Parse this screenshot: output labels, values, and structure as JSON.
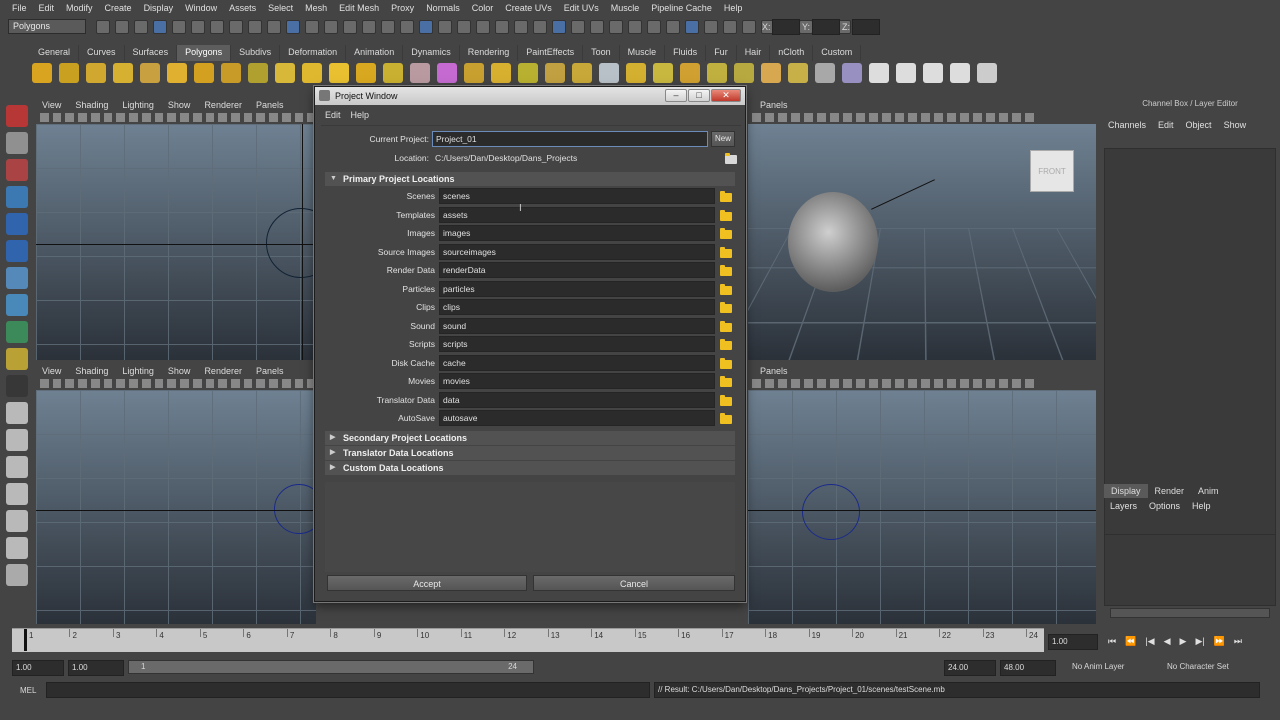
{
  "menubar": [
    "File",
    "Edit",
    "Modify",
    "Create",
    "Display",
    "Window",
    "Assets",
    "Select",
    "Mesh",
    "Edit Mesh",
    "Proxy",
    "Normals",
    "Color",
    "Create UVs",
    "Edit UVs",
    "Muscle",
    "Pipeline Cache",
    "Help"
  ],
  "statusline": {
    "mode": "Polygons",
    "x_label": "X:",
    "y_label": "Y:",
    "z_label": "Z:"
  },
  "shelf_tabs": [
    "General",
    "Curves",
    "Surfaces",
    "Polygons",
    "Subdivs",
    "Deformation",
    "Animation",
    "Dynamics",
    "Rendering",
    "PaintEffects",
    "Toon",
    "Muscle",
    "Fluids",
    "Fur",
    "Hair",
    "nCloth",
    "Custom"
  ],
  "shelf_active": "Polygons",
  "panel_menu": [
    "View",
    "Shading",
    "Lighting",
    "Show",
    "Renderer",
    "Panels"
  ],
  "viewcube_label": "FRONT",
  "channel_box": {
    "title": "Channel Box / Layer Editor",
    "menu": [
      "Channels",
      "Edit",
      "Object",
      "Show"
    ],
    "tabs": [
      "Display",
      "Render",
      "Anim"
    ],
    "layer_menu": [
      "Layers",
      "Options",
      "Help"
    ]
  },
  "timeline": {
    "ticks": [
      "1",
      "2",
      "3",
      "4",
      "5",
      "6",
      "7",
      "8",
      "9",
      "10",
      "11",
      "12",
      "13",
      "14",
      "15",
      "16",
      "17",
      "18",
      "19",
      "20",
      "21",
      "22",
      "23",
      "24"
    ],
    "current_frame": "1.00",
    "range_start": "1.00",
    "range_inner_start": "1.00",
    "range_slider_start": "1",
    "range_slider_end": "24",
    "range_inner_end": "24.00",
    "range_end": "48.00",
    "anim_layer": "No Anim Layer",
    "char_set": "No Character Set"
  },
  "command": {
    "label": "MEL",
    "result": "// Result: C:/Users/Dan/Desktop/Dans_Projects/Project_01/scenes/testScene.mb"
  },
  "project_window": {
    "title": "Project Window",
    "menu": [
      "Edit",
      "Help"
    ],
    "current_project_label": "Current Project:",
    "current_project": "Project_01",
    "new_button": "New",
    "location_label": "Location:",
    "location": "C:/Users/Dan/Desktop/Dans_Projects",
    "primary_section": "Primary Project Locations",
    "rows": [
      {
        "label": "Scenes",
        "value": "scenes"
      },
      {
        "label": "Templates",
        "value": "assets"
      },
      {
        "label": "Images",
        "value": "images"
      },
      {
        "label": "Source Images",
        "value": "sourceimages"
      },
      {
        "label": "Render Data",
        "value": "renderData"
      },
      {
        "label": "Particles",
        "value": "particles"
      },
      {
        "label": "Clips",
        "value": "clips"
      },
      {
        "label": "Sound",
        "value": "sound"
      },
      {
        "label": "Scripts",
        "value": "scripts"
      },
      {
        "label": "Disk Cache",
        "value": "cache"
      },
      {
        "label": "Movies",
        "value": "movies"
      },
      {
        "label": "Translator Data",
        "value": "data"
      },
      {
        "label": "AutoSave",
        "value": "autosave"
      }
    ],
    "collapsed_sections": [
      "Secondary Project Locations",
      "Translator Data Locations",
      "Custom Data Locations"
    ],
    "accept_button": "Accept",
    "cancel_button": "Cancel"
  }
}
